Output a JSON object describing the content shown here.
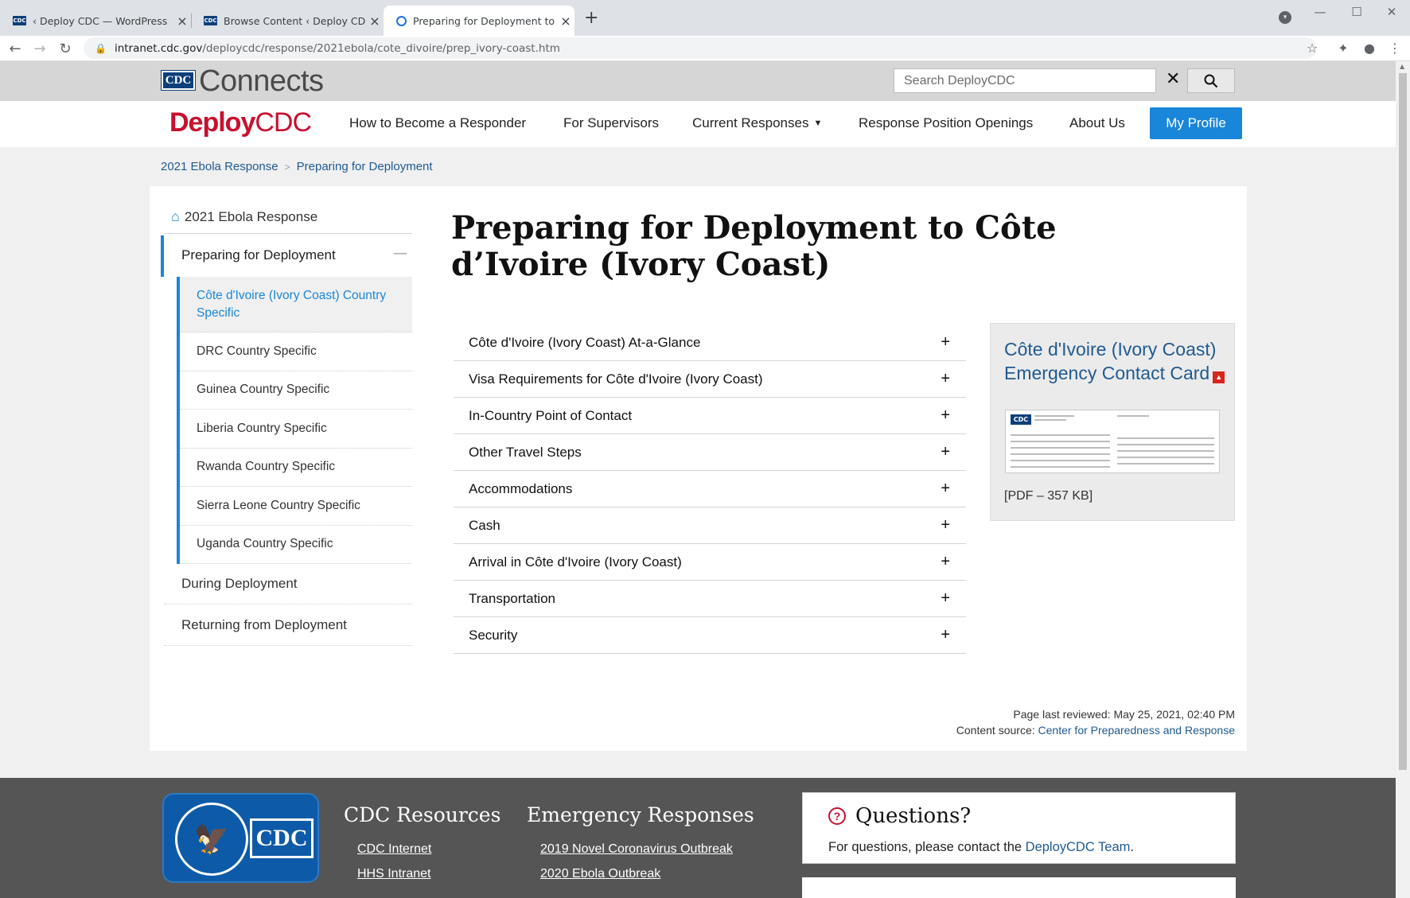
{
  "browser": {
    "tabs": [
      {
        "title": "‹ Deploy CDC — WordPress",
        "favicon": "cdc-favicon"
      },
      {
        "title": "Browse Content ‹ Deploy CDC —",
        "favicon": "cdc-favicon"
      },
      {
        "title": "Preparing for Deployment to Côt",
        "favicon": "loading-favicon",
        "active": true
      }
    ],
    "url_host": "intranet.cdc.gov",
    "url_path": "/deploycdc/response/2021ebola/cote_divoire/prep_ivory-coast.htm"
  },
  "header": {
    "logo_badge": "CDC",
    "logo_word": "Connects",
    "search_placeholder": "Search DeployCDC",
    "site_logo_part1": "Deploy",
    "site_logo_part2": "CDC",
    "nav": [
      {
        "label": "How to Become a Responder"
      },
      {
        "label": "For Supervisors"
      },
      {
        "label": "Current Responses",
        "has_dropdown": true
      },
      {
        "label": "Response Position Openings"
      },
      {
        "label": "About Us"
      }
    ],
    "profile_button": "My Profile",
    "accent_color": "#1a86d9",
    "brand_red": "#c8102e"
  },
  "breadcrumb": [
    {
      "label": "2021 Ebola Response"
    },
    {
      "label": "Preparing for Deployment"
    }
  ],
  "sidebar": {
    "home": "2021 Ebola Response",
    "active_section": "Preparing for Deployment",
    "sub_items": [
      {
        "label": "Côte d'Ivoire (Ivory Coast) Country Specific",
        "current": true
      },
      {
        "label": "DRC Country Specific"
      },
      {
        "label": "Guinea Country Specific"
      },
      {
        "label": "Liberia Country Specific"
      },
      {
        "label": "Rwanda Country Specific"
      },
      {
        "label": "Sierra Leone Country Specific"
      },
      {
        "label": "Uganda Country Specific"
      }
    ],
    "lower_items": [
      {
        "label": "During Deployment"
      },
      {
        "label": "Returning from Deployment"
      }
    ]
  },
  "main": {
    "title": "Preparing for Deployment to Côte d’Ivoire (Ivory Coast)",
    "accordion": [
      "Côte d'Ivoire (Ivory Coast) At-a-Glance",
      "Visa Requirements for Côte d'Ivoire (Ivory Coast)",
      "In-Country Point of Contact",
      "Other Travel Steps",
      "Accommodations",
      "Cash",
      "Arrival in Côte d'Ivoire (Ivory Coast)",
      "Transportation",
      "Security"
    ],
    "expand_symbol": "+",
    "pdf_card": {
      "title": "Côte d'Ivoire (Ivory Coast) Emergency Contact Card",
      "size": "[PDF – 357 KB]",
      "thumb_badge": "CDC"
    },
    "last_reviewed": "Page last reviewed: May 25, 2021, 02:40 PM",
    "content_source_label": "Content source: ",
    "content_source_link": "Center for Preparedness and Response"
  },
  "footer": {
    "logo_text": "CDC",
    "resources_heading": "CDC Resources",
    "resources_links": [
      "CDC Internet",
      "HHS Intranet"
    ],
    "emergency_heading": "Emergency Responses",
    "emergency_links": [
      "2019 Novel Coronavirus Outbreak",
      "2020 Ebola Outbreak"
    ],
    "questions_heading": "Questions?",
    "questions_text": "For questions, please contact the ",
    "questions_link": "DeployCDC Team",
    "questions_suffix": "."
  }
}
